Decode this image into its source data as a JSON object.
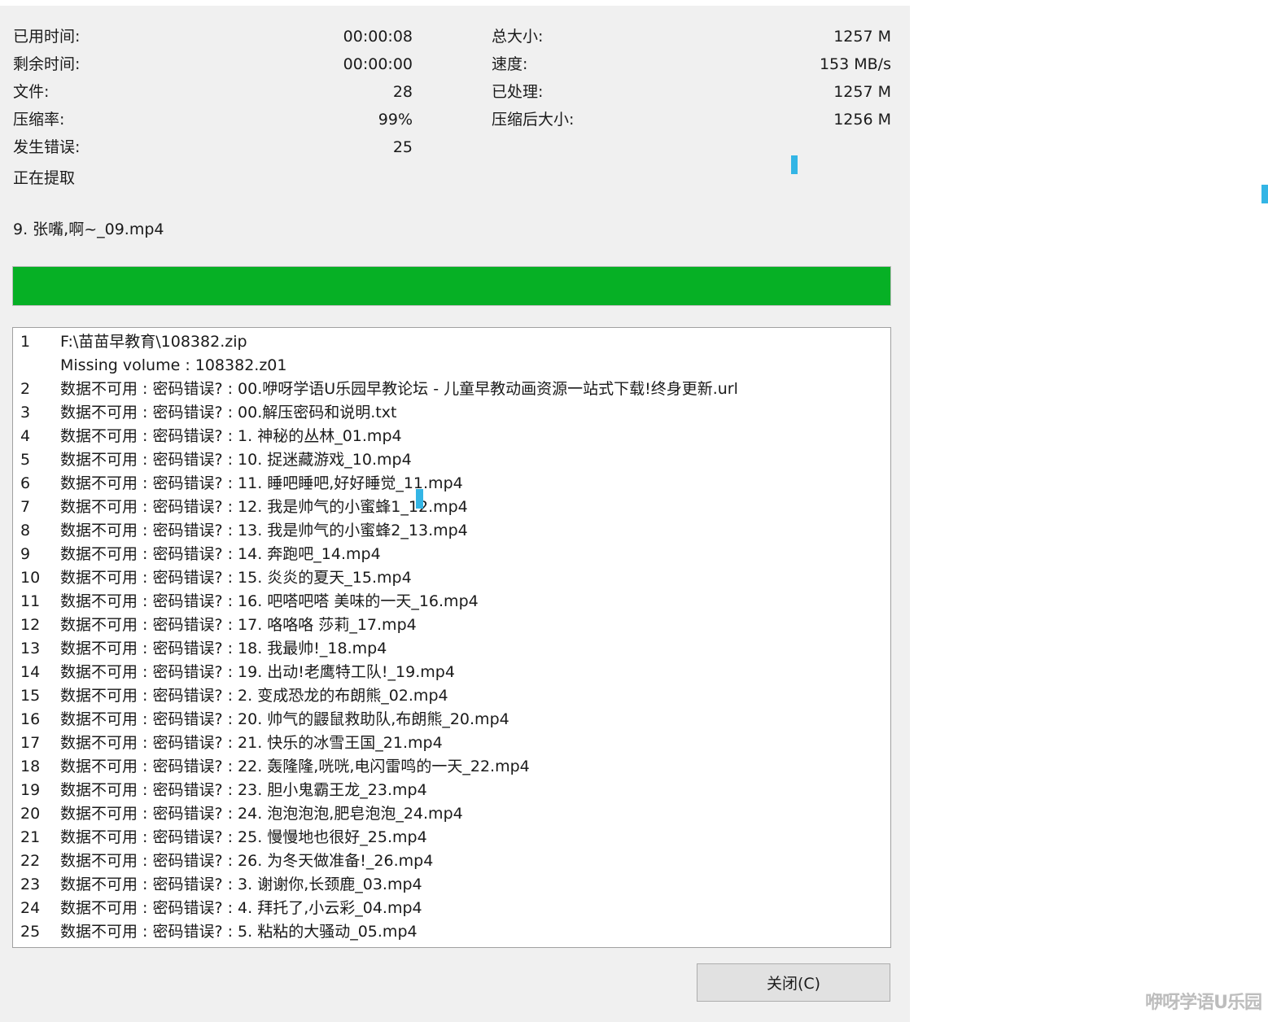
{
  "stats": {
    "elapsed_label": "已用时间:",
    "elapsed_value": "00:00:08",
    "remaining_label": "剩余时间:",
    "remaining_value": "00:00:00",
    "files_label": "文件:",
    "files_value": "28",
    "ratio_label": "压缩率:",
    "ratio_value": "99%",
    "errors_label": "发生错误:",
    "errors_value": "25",
    "total_label": "总大小:",
    "total_value": "1257 M",
    "speed_label": "速度:",
    "speed_value": "153 MB/s",
    "processed_label": "已处理:",
    "processed_value": "1257 M",
    "packed_label": "压缩后大小:",
    "packed_value": "1256 M"
  },
  "status": "正在提取",
  "current_file": "9. 张嘴,啊~_09.mp4",
  "progress": {
    "fraction": 1.0,
    "color": "#06b025"
  },
  "log": [
    {
      "num": "1",
      "msg": "F:\\苗苗早教育\\108382.zip"
    },
    {
      "num": "",
      "msg": "Missing volume : 108382.z01"
    },
    {
      "num": "2",
      "msg": "数据不可用 : 密码错误? : 00.咿呀学语U乐园早教论坛 - 儿童早教动画资源一站式下载!终身更新.url"
    },
    {
      "num": "3",
      "msg": "数据不可用 : 密码错误? : 00.解压密码和说明.txt"
    },
    {
      "num": "4",
      "msg": "数据不可用 : 密码错误? : 1. 神秘的丛林_01.mp4"
    },
    {
      "num": "5",
      "msg": "数据不可用 : 密码错误? : 10. 捉迷藏游戏_10.mp4"
    },
    {
      "num": "6",
      "msg": "数据不可用 : 密码错误? : 11. 睡吧睡吧,好好睡觉_11.mp4"
    },
    {
      "num": "7",
      "msg": "数据不可用 : 密码错误? : 12. 我是帅气的小蜜蜂1_12.mp4"
    },
    {
      "num": "8",
      "msg": "数据不可用 : 密码错误? : 13. 我是帅气的小蜜蜂2_13.mp4"
    },
    {
      "num": "9",
      "msg": "数据不可用 : 密码错误? : 14. 奔跑吧_14.mp4"
    },
    {
      "num": "10",
      "msg": "数据不可用 : 密码错误? : 15. 炎炎的夏天_15.mp4"
    },
    {
      "num": "11",
      "msg": "数据不可用 : 密码错误? : 16. 吧嗒吧嗒 美味的一天_16.mp4"
    },
    {
      "num": "12",
      "msg": "数据不可用 : 密码错误? : 17. 咯咯咯 莎莉_17.mp4"
    },
    {
      "num": "13",
      "msg": "数据不可用 : 密码错误? : 18. 我最帅!_18.mp4"
    },
    {
      "num": "14",
      "msg": "数据不可用 : 密码错误? : 19. 出动!老鹰特工队!_19.mp4"
    },
    {
      "num": "15",
      "msg": "数据不可用 : 密码错误? : 2. 变成恐龙的布朗熊_02.mp4"
    },
    {
      "num": "16",
      "msg": "数据不可用 : 密码错误? : 20. 帅气的鼹鼠救助队,布朗熊_20.mp4"
    },
    {
      "num": "17",
      "msg": "数据不可用 : 密码错误? : 21. 快乐的冰雪王国_21.mp4"
    },
    {
      "num": "18",
      "msg": "数据不可用 : 密码错误? : 22. 轰隆隆,咣咣,电闪雷鸣的一天_22.mp4"
    },
    {
      "num": "19",
      "msg": "数据不可用 : 密码错误? : 23. 胆小鬼霸王龙_23.mp4"
    },
    {
      "num": "20",
      "msg": "数据不可用 : 密码错误? : 24. 泡泡泡泡,肥皂泡泡_24.mp4"
    },
    {
      "num": "21",
      "msg": "数据不可用 : 密码错误? : 25. 慢慢地也很好_25.mp4"
    },
    {
      "num": "22",
      "msg": "数据不可用 : 密码错误? : 26. 为冬天做准备!_26.mp4"
    },
    {
      "num": "23",
      "msg": "数据不可用 : 密码错误? : 3. 谢谢你,长颈鹿_03.mp4"
    },
    {
      "num": "24",
      "msg": "数据不可用 : 密码错误? : 4. 拜托了,小云彩_04.mp4"
    },
    {
      "num": "25",
      "msg": "数据不可用 : 密码错误? : 5. 粘粘的大骚动_05.mp4"
    }
  ],
  "close_button_label": "关闭(C)",
  "watermark": "咿呀学语U乐园"
}
